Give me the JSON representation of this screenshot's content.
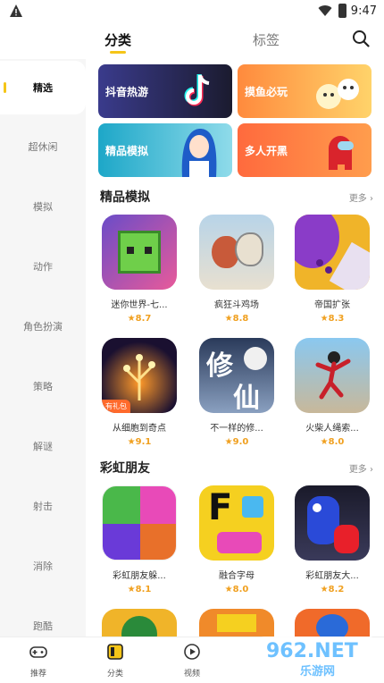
{
  "status": {
    "time": "9:47"
  },
  "tabs": [
    {
      "label": "分类"
    },
    {
      "label": "标签"
    }
  ],
  "sidebar": {
    "items": [
      {
        "label": "精选"
      },
      {
        "label": "超休闲"
      },
      {
        "label": "模拟"
      },
      {
        "label": "动作"
      },
      {
        "label": "角色扮演"
      },
      {
        "label": "策略"
      },
      {
        "label": "解谜"
      },
      {
        "label": "射击"
      },
      {
        "label": "消除"
      },
      {
        "label": "跑酷"
      }
    ]
  },
  "banners": [
    {
      "label": "抖音热游",
      "color": "#3a3b8c"
    },
    {
      "label": "摸鱼必玩",
      "color": "#ff9a3d"
    },
    {
      "label": "精品模拟",
      "color": "#1da7c8"
    },
    {
      "label": "多人开黑",
      "color": "#ff6a3d"
    }
  ],
  "sections": [
    {
      "title": "精品模拟",
      "more": "更多",
      "games": [
        {
          "name": "迷你世界-七...",
          "rating": "8.7"
        },
        {
          "name": "疯狂斗鸡场",
          "rating": "8.8"
        },
        {
          "name": "帝国扩张",
          "rating": "8.3"
        },
        {
          "name": "从细胞到奇点",
          "rating": "9.1",
          "badge": "有礼包"
        },
        {
          "name": "不一样的修...",
          "rating": "9.0"
        },
        {
          "name": "火柴人绳索...",
          "rating": "8.0"
        }
      ]
    },
    {
      "title": "彩虹朋友",
      "more": "更多",
      "games": [
        {
          "name": "彩虹朋友躲...",
          "rating": "8.1"
        },
        {
          "name": "融合字母",
          "rating": "8.0"
        },
        {
          "name": "彩虹朋友大...",
          "rating": "8.2"
        }
      ]
    }
  ],
  "icon_text": {
    "cultivation_1": "修",
    "cultivation_2": "仙",
    "letter_f": "F"
  },
  "bottom_nav": [
    {
      "label": "推荐"
    },
    {
      "label": "分类"
    },
    {
      "label": "视频"
    }
  ],
  "watermark": {
    "line1": "962.NET",
    "line2": "乐游网"
  },
  "colors": {
    "accent": "#f5c518",
    "rating": "#f0a020"
  }
}
